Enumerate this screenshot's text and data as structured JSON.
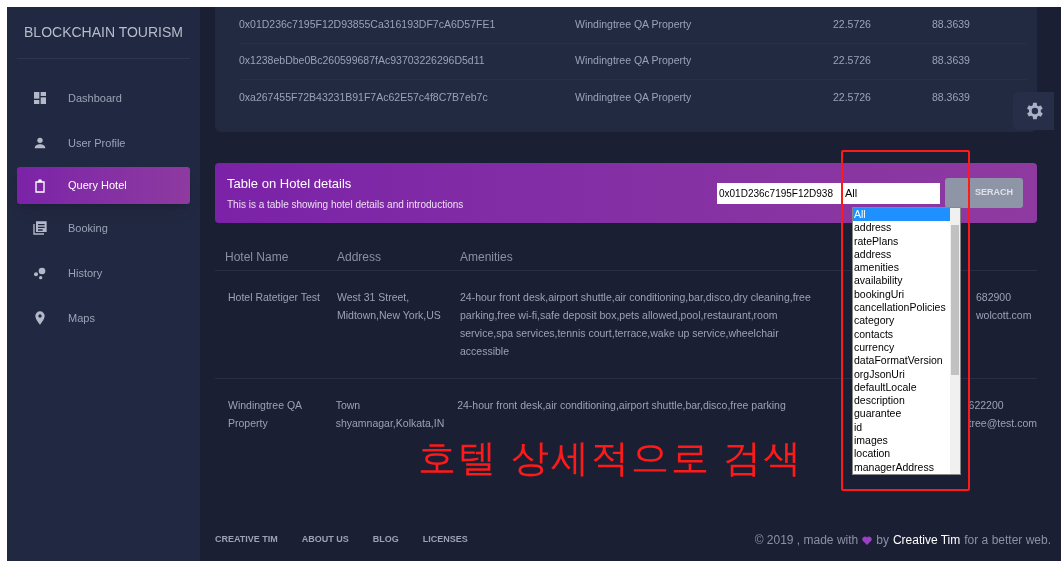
{
  "sidebar": {
    "brand": "BLOCKCHAIN TOURISM",
    "items": [
      {
        "label": "Dashboard",
        "selected": false
      },
      {
        "label": "User Profile",
        "selected": false
      },
      {
        "label": "Query Hotel",
        "selected": true
      },
      {
        "label": "Booking",
        "selected": false
      },
      {
        "label": "History",
        "selected": false
      },
      {
        "label": "Maps",
        "selected": false
      }
    ]
  },
  "top_table": {
    "rows": [
      [
        "0x01D236c7195F12D93855Ca316193DF7cA6D57FE1",
        "Windingtree QA Property",
        "22.5726",
        "88.3639"
      ],
      [
        "0x1238ebDbe0Bc260599687fAc93703226296D5d11",
        "Windingtree QA Property",
        "22.5726",
        "88.3639"
      ],
      [
        "0xa267455F72B43231B91F7Ac62E57c4f8C7B7eb7c",
        "Windingtree QA Property",
        "22.5726",
        "88.3639"
      ]
    ]
  },
  "hotel_card": {
    "title": "Table on Hotel details",
    "subtitle": "This is a table showing hotel details and introductions",
    "address_input": "0x01D236c7195F12D938",
    "select_value": "All",
    "button": "SERACH",
    "columns": [
      "Hotel Name",
      "Address",
      "Amenities"
    ],
    "rows": [
      {
        "name": "Hotel Ratetiger Test",
        "address": "West 31 Street, Midtown,New York,US",
        "amenities": "24-hour front desk,airport shuttle,air conditioning,bar,disco,dry cleaning,free parking,free wi-fi,safe deposit box,pets allowed,pool,restaurant,room service,spa services,tennis court,terrace,wake up service,wheelchair accessible",
        "column_4": [
          "682900",
          "wolcott.com"
        ]
      },
      {
        "name": "Windingtree QA Property",
        "address": "Town shyamnagar,Kolkata,IN",
        "amenities": "24-hour front desk,air conditioning,airport shuttle,bar,disco,free parking",
        "column_4": [
          "622200",
          "tree@test.com"
        ]
      }
    ]
  },
  "dropdown": {
    "options": [
      {
        "label": "All",
        "selected": true
      },
      {
        "label": "address",
        "selected": false
      },
      {
        "label": "ratePlans",
        "selected": false
      },
      {
        "label": "address",
        "selected": false
      },
      {
        "label": "amenities",
        "selected": false
      },
      {
        "label": "availability",
        "selected": false
      },
      {
        "label": "bookingUri",
        "selected": false
      },
      {
        "label": "cancellationPolicies",
        "selected": false
      },
      {
        "label": "category",
        "selected": false
      },
      {
        "label": "contacts",
        "selected": false
      },
      {
        "label": "currency",
        "selected": false
      },
      {
        "label": "dataFormatVersion",
        "selected": false
      },
      {
        "label": "orgJsonUri",
        "selected": false
      },
      {
        "label": "defaultLocale",
        "selected": false
      },
      {
        "label": "description",
        "selected": false
      },
      {
        "label": "guarantee",
        "selected": false
      },
      {
        "label": "id",
        "selected": false
      },
      {
        "label": "images",
        "selected": false
      },
      {
        "label": "location",
        "selected": false
      },
      {
        "label": "managerAddress",
        "selected": false
      }
    ]
  },
  "annotation": "호텔 상세적으로 검색",
  "footer": {
    "links": [
      "CREATIVE TIM",
      "ABOUT US",
      "BLOG",
      "LICENSES"
    ],
    "copyright": "© 2019 , made with",
    "by": "by",
    "author": "Creative Tim",
    "tail": "for a better web."
  }
}
